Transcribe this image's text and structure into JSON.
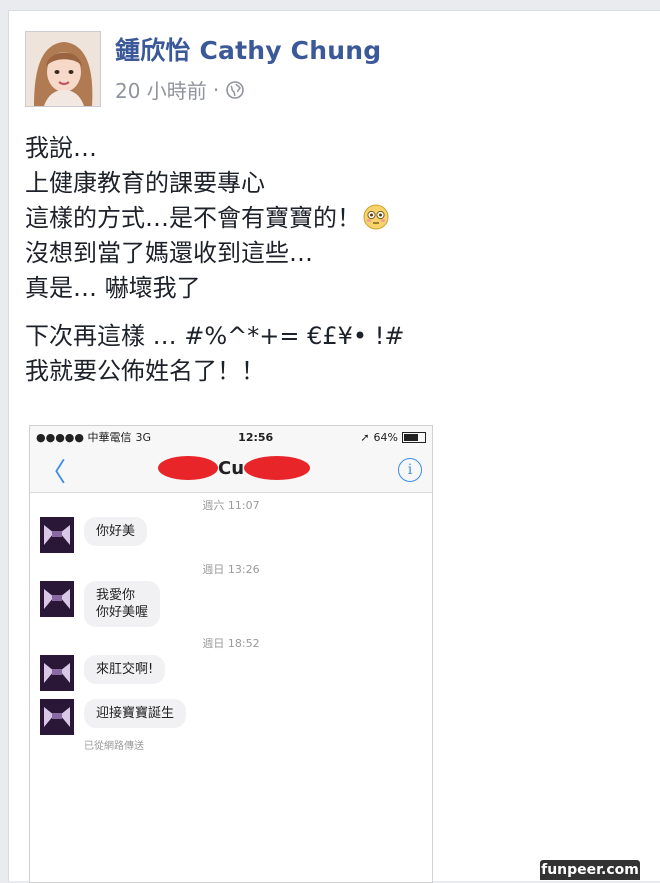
{
  "post": {
    "author": "鍾欣怡 Cathy Chung",
    "time": "20 小時前",
    "separator": "·",
    "privacy_icon": "globe-icon",
    "avatar_icon": "profile-photo",
    "paragraphs": [
      [
        "我說…",
        "上健康教育的課要專心",
        "這樣的方式…是不會有寶寶的！",
        "沒想到當了媽還收到這些…",
        "真是… 嚇壞我了"
      ],
      [
        "下次再這樣 … #%^*+= €£¥• !#",
        "我就要公佈姓名了！！"
      ]
    ],
    "emoji_icon": "flushed-face-emoji"
  },
  "phone": {
    "carrier": "●●●●● 中華電信",
    "network": "3G",
    "time": "12:56",
    "battery": "64%",
    "battery_icon": "battery-icon",
    "back_icon": "chevron-left-icon",
    "back_glyph": "〈",
    "contact_visible": "Cu",
    "info_icon": "info-icon",
    "info_glyph": "i",
    "thread": [
      {
        "stamp": "週六 11:07"
      },
      {
        "message": [
          "你好美"
        ]
      },
      {
        "stamp": "週日 13:26"
      },
      {
        "message": [
          "我愛你",
          "你好美喔"
        ]
      },
      {
        "stamp": "週日 18:52"
      },
      {
        "message": [
          "來肛交啊!"
        ]
      },
      {
        "message": [
          "迎接寶寶誕生"
        ]
      },
      {
        "delivered": "已從網路傳送"
      }
    ]
  },
  "watermark": "funpeer.com",
  "colors": {
    "author": "#3b5998",
    "ios_blue": "#3a8ee6",
    "redaction": "#e8262a"
  }
}
